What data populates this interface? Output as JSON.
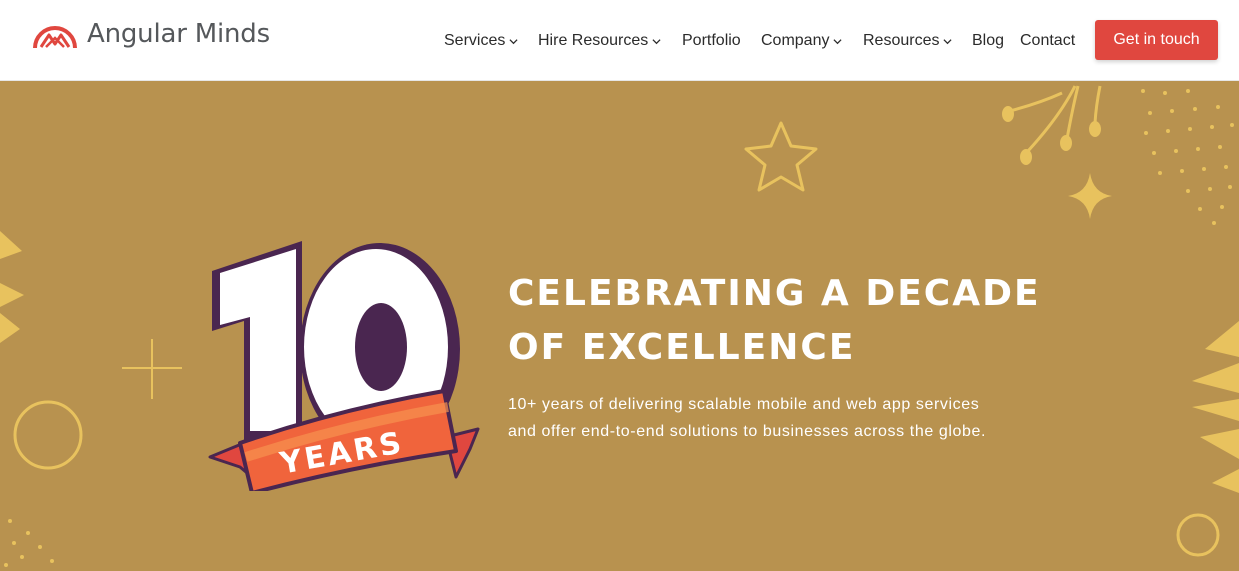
{
  "brand": {
    "name": "Angular Minds",
    "logo_icon": "mountain-arc-logo",
    "color": "#e0473f"
  },
  "nav": {
    "items": [
      {
        "label": "Services",
        "dropdown": true
      },
      {
        "label": "Hire Resources",
        "dropdown": true
      },
      {
        "label": "Portfolio",
        "dropdown": false
      },
      {
        "label": "Company",
        "dropdown": true
      },
      {
        "label": "Resources",
        "dropdown": true
      },
      {
        "label": "Blog",
        "dropdown": false
      },
      {
        "label": "Contact",
        "dropdown": false
      }
    ],
    "cta_label": "Get in touch"
  },
  "hero": {
    "badge": {
      "number": "10",
      "ribbon_text": "YEARS"
    },
    "headline_line1": "CELEBRATING A DECADE",
    "headline_line2": "OF EXCELLENCE",
    "subtext_line1": "10+ years of delivering scalable mobile and web app services",
    "subtext_line2": "and offer end-to-end solutions to businesses across the globe.",
    "colors": {
      "background": "#b8924f",
      "decor": "#e8c25e",
      "badge_outline": "#4a2650",
      "ribbon": "#f0643c"
    }
  }
}
